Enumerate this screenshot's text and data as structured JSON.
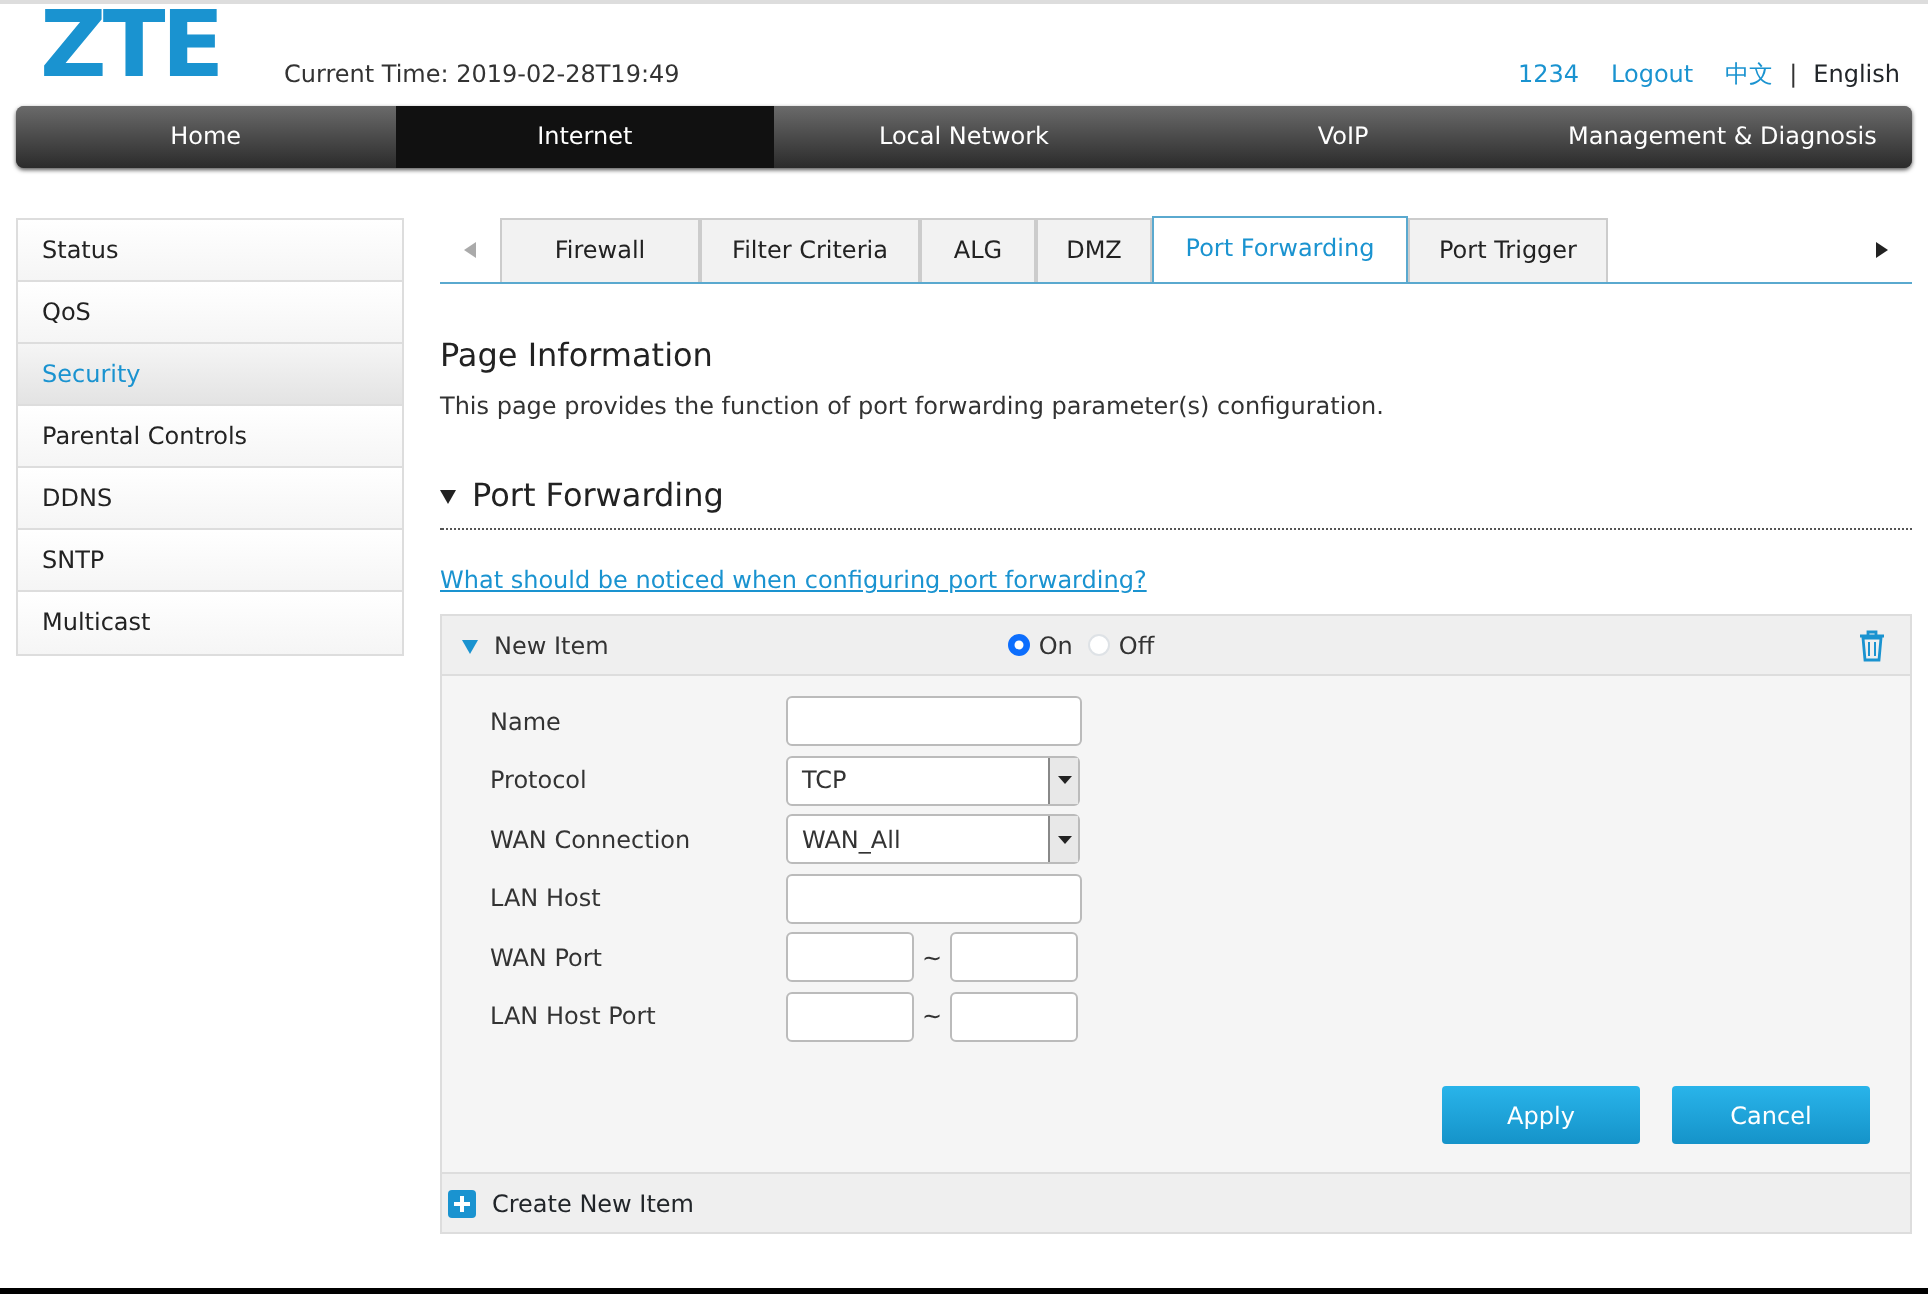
{
  "header": {
    "logo": "ZTE",
    "current_time": "Current Time: 2019-02-28T19:49",
    "user": "1234",
    "logout": "Logout",
    "languages": [
      {
        "label": "中文",
        "selected": false
      },
      {
        "label": "English",
        "selected": true
      }
    ],
    "language_separator": "|"
  },
  "main_menu": [
    {
      "label": "Home",
      "selected": false
    },
    {
      "label": "Internet",
      "selected": true
    },
    {
      "label": "Local Network",
      "selected": false
    },
    {
      "label": "VoIP",
      "selected": false
    },
    {
      "label": "Management & Diagnosis",
      "selected": false
    }
  ],
  "sidebar": {
    "items": [
      {
        "label": "Status",
        "selected": false
      },
      {
        "label": "QoS",
        "selected": false
      },
      {
        "label": "Security",
        "selected": true
      },
      {
        "label": "Parental Controls",
        "selected": false
      },
      {
        "label": "DDNS",
        "selected": false
      },
      {
        "label": "SNTP",
        "selected": false
      },
      {
        "label": "Multicast",
        "selected": false
      }
    ]
  },
  "tabs": [
    {
      "label": "Firewall",
      "selected": false
    },
    {
      "label": "Filter Criteria",
      "selected": false
    },
    {
      "label": "ALG",
      "selected": false
    },
    {
      "label": "DMZ",
      "selected": false
    },
    {
      "label": "Port Forwarding",
      "selected": true
    },
    {
      "label": "Port Trigger",
      "selected": false
    }
  ],
  "page_info": {
    "title": "Page Information",
    "description": "This page provides the function of port forwarding parameter(s) configuration."
  },
  "section": {
    "title": "Port Forwarding",
    "expanded": true,
    "help_link": "What should be noticed when configuring port forwarding?"
  },
  "item": {
    "title": "New Item",
    "expanded": true,
    "switch": [
      {
        "label": "On",
        "selected": true
      },
      {
        "label": "Off",
        "selected": false
      }
    ],
    "fields": [
      {
        "label": "Name",
        "kind": "text"
      },
      {
        "label": "Protocol",
        "kind": "select",
        "value": "TCP"
      },
      {
        "label": "WAN Connection",
        "kind": "select",
        "value": "WAN_All"
      },
      {
        "label": "LAN Host",
        "kind": "text"
      },
      {
        "label": "WAN Port",
        "kind": "range",
        "separator": "~"
      },
      {
        "label": "LAN Host Port",
        "kind": "range",
        "separator": "~"
      }
    ],
    "buttons": [
      "Apply",
      "Cancel"
    ]
  },
  "create_new": "Create New Item"
}
